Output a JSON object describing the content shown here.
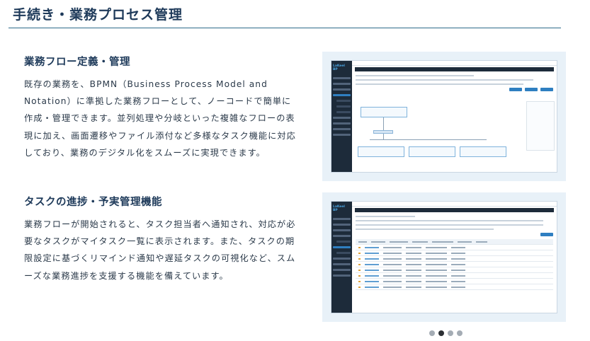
{
  "page": {
    "title": "手続き・業務プロセス管理"
  },
  "sections": [
    {
      "heading": "業務フロー定義・管理",
      "body": "既存の業務を、BPMN（Business Process Model and Notation）に準拠した業務フローとして、ノーコードで簡単に作成・管理できます。並列処理や分岐といった複雑なフローの表現に加え、画面遷移やファイル添付など多様なタスク機能に対応しており、業務のデジタル化をスムーズに実現できます。"
    },
    {
      "heading": "タスクの進捗・予実管理機能",
      "body": "業務フローが開始されると、タスク担当者へ通知され、対応が必要なタスクがマイタスク一覧に表示されます。また、タスクの期限設定に基づくリマインド通知や遅延タスクの可視化など、スムーズな業務進捗を支援する機能を備えています。"
    }
  ],
  "screenshots": {
    "logo_text": "LaKeel",
    "logo_suffix": "BP"
  },
  "carousel": {
    "count": 4,
    "active_index": 1
  }
}
